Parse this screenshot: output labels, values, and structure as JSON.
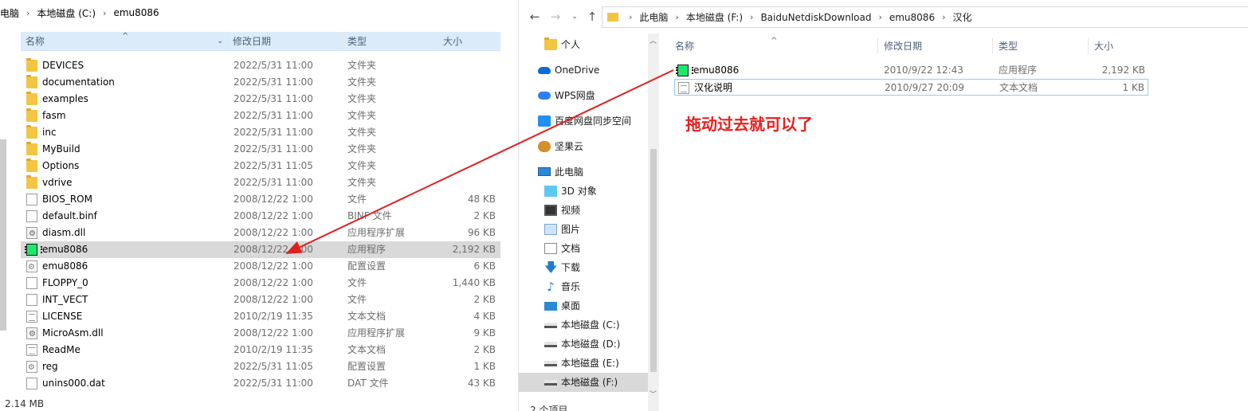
{
  "left_window": {
    "breadcrumb": [
      "电脑",
      "本地磁盘 (C:)",
      "emu8086"
    ],
    "columns": {
      "name": "名称",
      "date": "修改日期",
      "type": "类型",
      "size": "大小"
    },
    "files": [
      {
        "name": "DEVICES",
        "date": "2022/5/31 11:00",
        "type": "文件夹",
        "size": "",
        "icon": "folder-icon"
      },
      {
        "name": "documentation",
        "date": "2022/5/31 11:00",
        "type": "文件夹",
        "size": "",
        "icon": "folder-icon"
      },
      {
        "name": "examples",
        "date": "2022/5/31 11:00",
        "type": "文件夹",
        "size": "",
        "icon": "folder-icon"
      },
      {
        "name": "fasm",
        "date": "2022/5/31 11:00",
        "type": "文件夹",
        "size": "",
        "icon": "folder-icon"
      },
      {
        "name": "inc",
        "date": "2022/5/31 11:00",
        "type": "文件夹",
        "size": "",
        "icon": "folder-icon"
      },
      {
        "name": "MyBuild",
        "date": "2022/5/31 11:00",
        "type": "文件夹",
        "size": "",
        "icon": "folder-icon"
      },
      {
        "name": "Options",
        "date": "2022/5/31 11:05",
        "type": "文件夹",
        "size": "",
        "icon": "folder-icon"
      },
      {
        "name": "vdrive",
        "date": "2022/5/31 11:00",
        "type": "文件夹",
        "size": "",
        "icon": "folder-icon"
      },
      {
        "name": "BIOS_ROM",
        "date": "2008/12/22 1:00",
        "type": "文件",
        "size": "48 KB",
        "icon": "file-icon"
      },
      {
        "name": "default.binf",
        "date": "2008/12/22 1:00",
        "type": "BINF 文件",
        "size": "2 KB",
        "icon": "file-icon"
      },
      {
        "name": "diasm.dll",
        "date": "2008/12/22 1:00",
        "type": "应用程序扩展",
        "size": "96 KB",
        "icon": "dll-icon"
      },
      {
        "name": "emu8086",
        "date": "2008/12/22 1:00",
        "type": "应用程序",
        "size": "2,192 KB",
        "icon": "exe-icon",
        "selected": true
      },
      {
        "name": "emu8086",
        "date": "2008/12/22 1:00",
        "type": "配置设置",
        "size": "6 KB",
        "icon": "config-icon"
      },
      {
        "name": "FLOPPY_0",
        "date": "2008/12/22 1:00",
        "type": "文件",
        "size": "1,440 KB",
        "icon": "file-icon"
      },
      {
        "name": "INT_VECT",
        "date": "2008/12/22 1:00",
        "type": "文件",
        "size": "2 KB",
        "icon": "file-icon"
      },
      {
        "name": "LICENSE",
        "date": "2010/2/19 11:35",
        "type": "文本文档",
        "size": "4 KB",
        "icon": "text-file-icon"
      },
      {
        "name": "MicroAsm.dll",
        "date": "2008/12/22 1:00",
        "type": "应用程序扩展",
        "size": "9 KB",
        "icon": "dll-icon"
      },
      {
        "name": "ReadMe",
        "date": "2010/2/19 11:35",
        "type": "文本文档",
        "size": "2 KB",
        "icon": "text-file-icon"
      },
      {
        "name": "reg",
        "date": "2022/5/31 11:05",
        "type": "配置设置",
        "size": "1 KB",
        "icon": "config-icon"
      },
      {
        "name": "unins000.dat",
        "date": "2022/5/31 11:00",
        "type": "DAT 文件",
        "size": "43 KB",
        "icon": "file-icon"
      }
    ],
    "status": "2.14 MB"
  },
  "right_window": {
    "breadcrumb": [
      "此电脑",
      "本地磁盘 (F:)",
      "BaiduNetdiskDownload",
      "emu8086",
      "汉化"
    ],
    "nav_items": [
      {
        "label": "个人",
        "icon": "folder-icon",
        "indent": 1
      },
      {
        "label": "OneDrive",
        "icon": "onedrive-icon",
        "indent": 0
      },
      {
        "label": "WPS网盘",
        "icon": "wps-cloud-icon",
        "indent": 0
      },
      {
        "label": "百度网盘同步空间",
        "icon": "baidu-netdisk-icon",
        "indent": 0
      },
      {
        "label": "坚果云",
        "icon": "nutstore-icon",
        "indent": 0
      },
      {
        "label": "此电脑",
        "icon": "this-pc-icon",
        "indent": 0
      },
      {
        "label": "3D 对象",
        "icon": "3d-objects-icon",
        "indent": 1
      },
      {
        "label": "视频",
        "icon": "video-icon",
        "indent": 1
      },
      {
        "label": "图片",
        "icon": "picture-icon",
        "indent": 1
      },
      {
        "label": "文档",
        "icon": "document-icon",
        "indent": 1
      },
      {
        "label": "下载",
        "icon": "download-icon",
        "indent": 1
      },
      {
        "label": "音乐",
        "icon": "music-icon",
        "indent": 1
      },
      {
        "label": "桌面",
        "icon": "desktop-icon",
        "indent": 1
      },
      {
        "label": "本地磁盘 (C:)",
        "icon": "drive-icon",
        "indent": 1
      },
      {
        "label": "本地磁盘 (D:)",
        "icon": "drive-icon",
        "indent": 1
      },
      {
        "label": "本地磁盘 (E:)",
        "icon": "drive-icon",
        "indent": 1
      },
      {
        "label": "本地磁盘 (F:)",
        "icon": "drive-icon",
        "indent": 1,
        "selected": true
      }
    ],
    "columns": {
      "name": "名称",
      "date": "修改日期",
      "type": "类型",
      "size": "大小"
    },
    "files": [
      {
        "name": "emu8086",
        "date": "2010/9/22 12:43",
        "type": "应用程序",
        "size": "2,192 KB",
        "icon": "exe-icon"
      },
      {
        "name": "汉化说明",
        "date": "2010/9/27 20:09",
        "type": "文本文档",
        "size": "1 KB",
        "icon": "text-file-icon"
      }
    ],
    "status": "2 个项目"
  },
  "annotation": {
    "text": "拖动过去就可以了",
    "color": "#e8201f"
  }
}
